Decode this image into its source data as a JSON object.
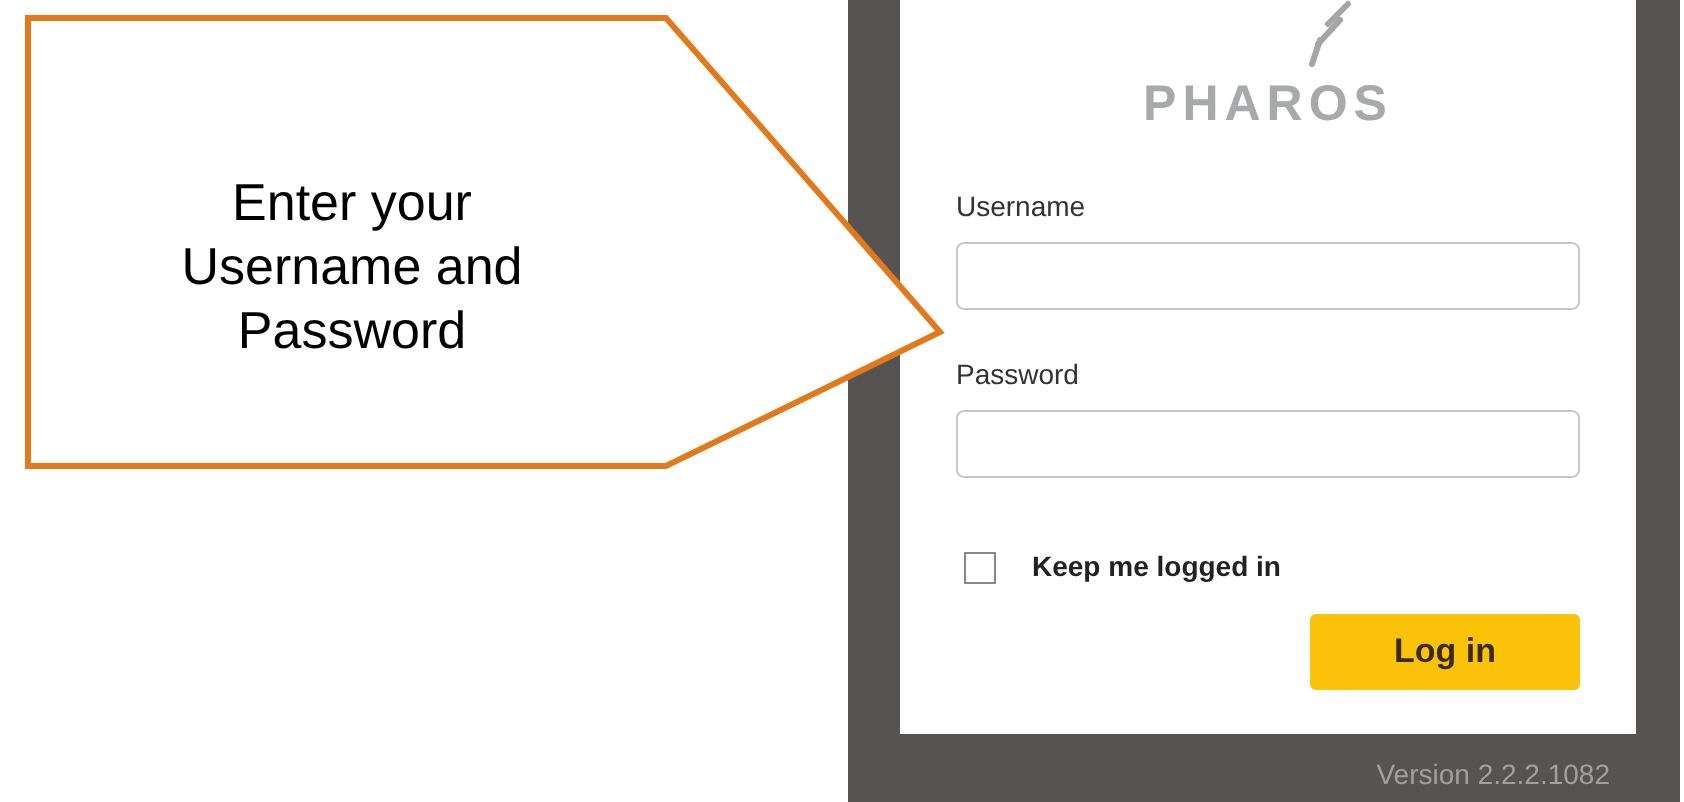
{
  "callout": {
    "text": "Enter your Username and Password"
  },
  "login": {
    "logo_text": "PHAROS",
    "fields": [
      {
        "label": "Username"
      },
      {
        "label": "Password"
      }
    ],
    "keep_logged_in": {
      "label": "Keep me logged in",
      "checked": false
    },
    "button": "Log in",
    "version": "Version 2.2.2.1082"
  }
}
